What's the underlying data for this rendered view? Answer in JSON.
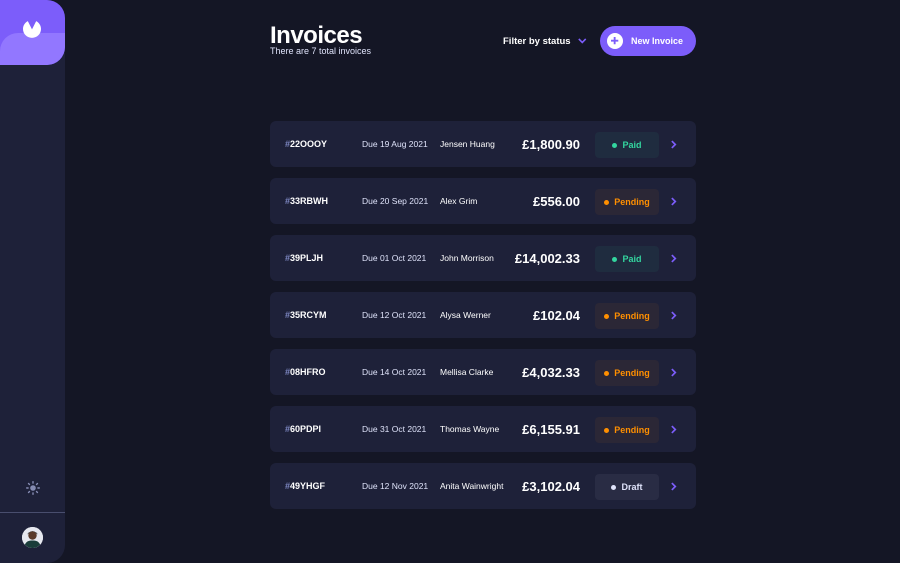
{
  "sidebar": {
    "logo_icon": "app-logo-icon",
    "theme_icon": "sun-icon",
    "avatar_icon": "user-avatar"
  },
  "header": {
    "title": "Invoices",
    "subtitle": "There are 7 total invoices",
    "filter_label": "Filter by status",
    "new_invoice_label": "New Invoice"
  },
  "colors": {
    "background": "#141625",
    "panel": "#1e2139",
    "accent": "#7c5dfa",
    "paid": "#33d69f",
    "pending": "#ff8f00",
    "draft": "#dfe3fa"
  },
  "invoices": [
    {
      "hash": "#",
      "id": "22OOOY",
      "due": "Due 19 Aug 2021",
      "client": "Jensen Huang",
      "amount": "£1,800.90",
      "status": "Paid",
      "status_key": "paid"
    },
    {
      "hash": "#",
      "id": "33RBWH",
      "due": "Due 20 Sep 2021",
      "client": "Alex Grim",
      "amount": "£556.00",
      "status": "Pending",
      "status_key": "pending"
    },
    {
      "hash": "#",
      "id": "39PLJH",
      "due": "Due 01 Oct 2021",
      "client": "John Morrison",
      "amount": "£14,002.33",
      "status": "Paid",
      "status_key": "paid"
    },
    {
      "hash": "#",
      "id": "35RCYM",
      "due": "Due 12 Oct 2021",
      "client": "Alysa Werner",
      "amount": "£102.04",
      "status": "Pending",
      "status_key": "pending"
    },
    {
      "hash": "#",
      "id": "08HFRO",
      "due": "Due 14 Oct 2021",
      "client": "Mellisa Clarke",
      "amount": "£4,032.33",
      "status": "Pending",
      "status_key": "pending"
    },
    {
      "hash": "#",
      "id": "60PDPI",
      "due": "Due 31 Oct 2021",
      "client": "Thomas Wayne",
      "amount": "£6,155.91",
      "status": "Pending",
      "status_key": "pending"
    },
    {
      "hash": "#",
      "id": "49YHGF",
      "due": "Due 12 Nov 2021",
      "client": "Anita Wainwright",
      "amount": "£3,102.04",
      "status": "Draft",
      "status_key": "draft"
    }
  ]
}
